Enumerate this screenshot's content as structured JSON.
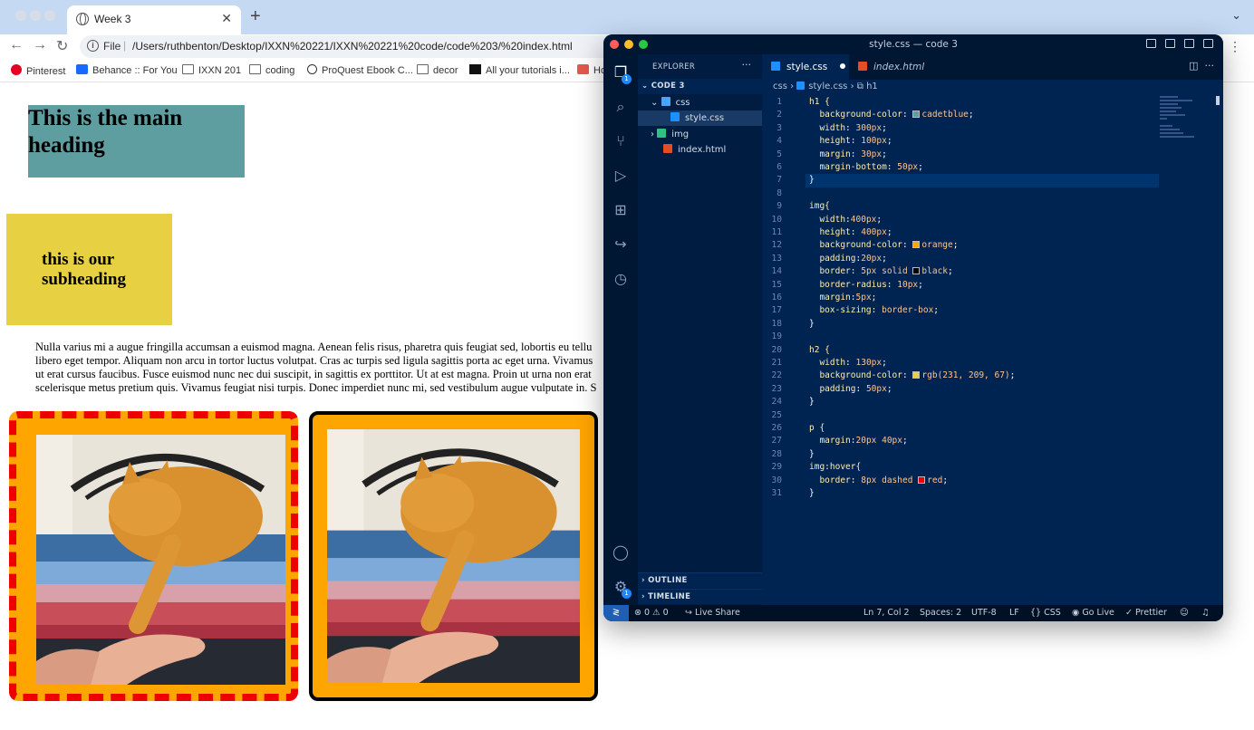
{
  "browser": {
    "tab_title": "Week 3",
    "new_tab": "+",
    "omnibox": {
      "scheme_label": "File",
      "url": "/Users/ruthbenton/Desktop/IXXN%20221/IXXN%20221%20code/code%203/%20index.html"
    },
    "bookmarks": [
      {
        "label": "Pinterest",
        "icon": "pinterest-icon"
      },
      {
        "label": "Behance :: For You",
        "icon": "behance-icon"
      },
      {
        "label": "IXXN 201",
        "icon": "folder-icon"
      },
      {
        "label": "coding",
        "icon": "folder-icon"
      },
      {
        "label": "ProQuest Ebook C...",
        "icon": "globe-icon"
      },
      {
        "label": "decor",
        "icon": "folder-icon"
      },
      {
        "label": "All your tutorials i...",
        "icon": "site-icon"
      },
      {
        "label": "Ho",
        "icon": "site-icon"
      }
    ]
  },
  "page": {
    "h1": "This is the main heading",
    "h2": "this is our subheading",
    "paragraph_lines": [
      "Nulla varius mi a augue fringilla accumsan a euismod magna. Aenean felis risus, pharetra quis feugiat sed, lobortis eu tellu",
      "libero eget tempor. Aliquam non arcu in tortor luctus volutpat. Cras ac turpis sed ligula sagittis porta ac eget urna. Vivamus",
      "ut erat cursus faucibus. Fusce euismod nunc nec dui suscipit, in sagittis ex porttitor. Ut at est magna. Proin ut urna non erat",
      "scelerisque metus pretium quis. Vivamus feugiat nisi turpis. Donec imperdiet nunc mi, sed vestibulum augue vulputate in. S"
    ],
    "colors": {
      "h1_bg": "#5f9ea0",
      "h2_bg": "rgb(231, 209, 67)",
      "img_bg": "orange",
      "hover_border": "red"
    }
  },
  "vscode": {
    "window_title": "style.css — code 3",
    "explorer": {
      "header": "EXPLORER",
      "more": "···",
      "project": "CODE 3",
      "items": [
        {
          "label": "css",
          "type": "folder",
          "chevron": "⌄"
        },
        {
          "label": "style.css",
          "type": "css"
        },
        {
          "label": "img",
          "type": "folder",
          "chevron": "›"
        },
        {
          "label": "index.html",
          "type": "html"
        }
      ],
      "outline": "OUTLINE",
      "timeline": "TIMELINE"
    },
    "tabs": [
      {
        "label": "style.css",
        "modified": true
      },
      {
        "label": "index.html",
        "modified": false
      }
    ],
    "breadcrumb": {
      "folder": "css",
      "file": "style.css",
      "symbol": "h1"
    },
    "badges": {
      "explorer": "1",
      "settings": "1"
    },
    "code_lines": [
      "h1 {",
      "  background-color: cadetblue;",
      "  width: 300px;",
      "  height: 100px;",
      "  margin: 30px;",
      "  margin-bottom: 50px;",
      "}",
      "",
      "img{",
      "  width:400px;",
      "  height: 400px;",
      "  background-color: orange;",
      "  padding:20px;",
      "  border: 5px solid black;",
      "  border-radius: 10px;",
      "  margin:5px;",
      "  box-sizing: border-box;",
      "}",
      "",
      "h2 {",
      "  width: 130px;",
      "  background-color: rgb(231, 209, 67);",
      "  padding: 50px;",
      "}",
      "",
      "p {",
      "  margin:20px 40px;",
      "}",
      "img:hover{",
      "  border: 8px dashed red;",
      "}"
    ],
    "status": {
      "problems": "⊗ 0 ⚠ 0",
      "live_share": "Live Share",
      "position": "Ln 7, Col 2",
      "spaces": "Spaces: 2",
      "encoding": "UTF-8",
      "eol": "LF",
      "language": "CSS",
      "go_live": "Go Live",
      "prettier": "Prettier"
    }
  }
}
